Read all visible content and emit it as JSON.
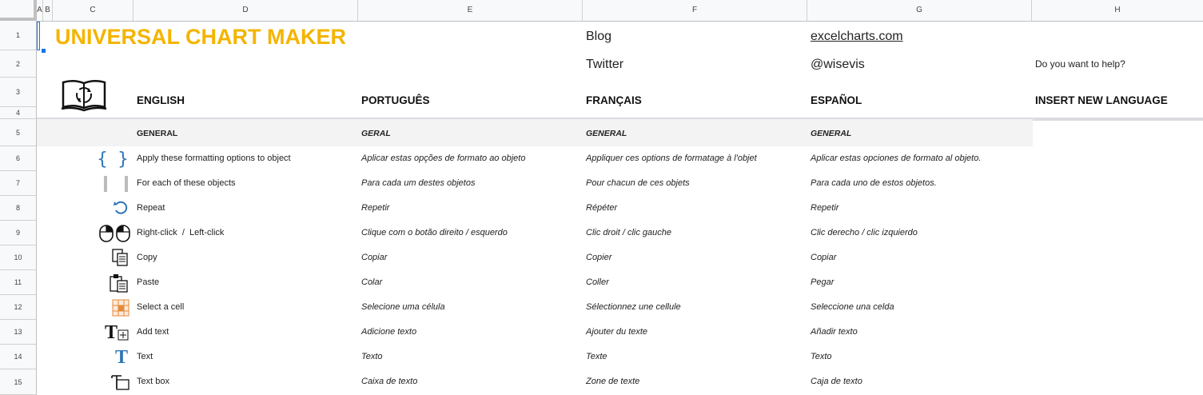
{
  "columns": [
    "A",
    "B",
    "C",
    "D",
    "E",
    "F",
    "G",
    "H"
  ],
  "rows": [
    "1",
    "2",
    "3",
    "4",
    "5",
    "6",
    "7",
    "8",
    "9",
    "10",
    "11",
    "12",
    "13",
    "14",
    "15"
  ],
  "title": "UNIVERSAL CHART MAKER",
  "links": {
    "blog_label": "Blog",
    "blog_value": "excelcharts.com",
    "twitter_label": "Twitter",
    "twitter_value": "@wisevis",
    "help": "Do you want to help?"
  },
  "languages": {
    "english": "ENGLISH",
    "portugues": "PORTUGUÊS",
    "francais": "FRANÇAIS",
    "espanol": "ESPAÑOL",
    "insert": "INSERT NEW LANGUAGE"
  },
  "general": {
    "en": "GENERAL",
    "pt": "GERAL",
    "fr": "GENERAL",
    "es": "GENERAL"
  },
  "terms": [
    {
      "icon": "braces-icon",
      "en": "Apply these formatting options to object",
      "pt": "Aplicar estas opções de formato ao objeto",
      "fr": "Appliquer ces options de formatage à l'objet",
      "es": "Aplicar estas opciones de formato al objeto."
    },
    {
      "icon": "bars-icon",
      "en": "For each of these objects",
      "pt": "Para cada um destes objetos",
      "fr": "Pour chacun de ces objets",
      "es": "Para cada uno de estos objetos."
    },
    {
      "icon": "repeat-icon",
      "en": "Repeat",
      "pt": "Repetir",
      "fr": "Répéter",
      "es": "Repetir"
    },
    {
      "icon": "mouse-icon",
      "en": "Right-click  /  Left-click",
      "pt": "Clique com o botão direito / esquerdo",
      "fr": "Clic droit / clic gauche",
      "es": "Clic derecho / clic izquierdo"
    },
    {
      "icon": "copy-icon",
      "en": "Copy",
      "pt": "Copiar",
      "fr": "Copier",
      "es": "Copiar"
    },
    {
      "icon": "paste-icon",
      "en": "Paste",
      "pt": "Colar",
      "fr": "Coller",
      "es": "Pegar"
    },
    {
      "icon": "select-cell-icon",
      "en": "Select a cell",
      "pt": "Selecione uma célula",
      "fr": "Sélectionnez une cellule",
      "es": "Seleccione una celda"
    },
    {
      "icon": "add-text-icon",
      "en": "Add text",
      "pt": "Adicione texto",
      "fr": "Ajouter du texte",
      "es": "Añadir texto"
    },
    {
      "icon": "text-icon",
      "en": "Text",
      "pt": "Texto",
      "fr": "Texte",
      "es": "Texto"
    },
    {
      "icon": "text-box-icon",
      "en": "Text box",
      "pt": "Caixa de texto",
      "fr": "Zone de texte",
      "es": "Caja de texto"
    }
  ]
}
